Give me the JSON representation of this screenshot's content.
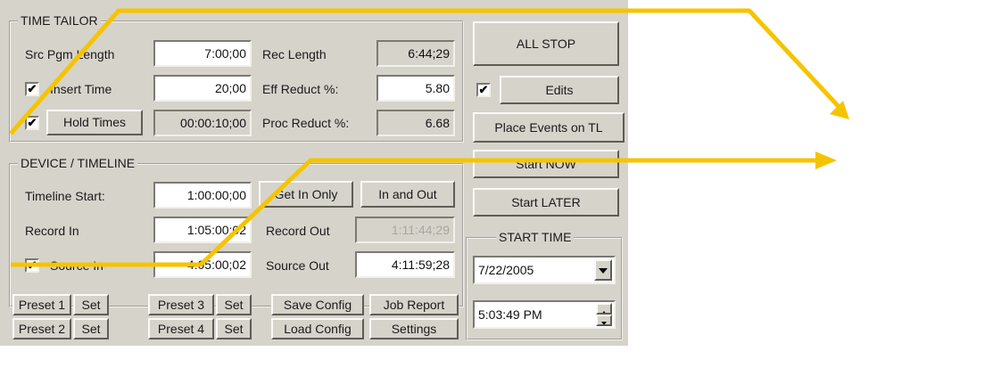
{
  "time_tailor": {
    "title": "TIME TAILOR",
    "src_pgm_length_label": "Src Pgm Length",
    "src_pgm_length_value": "7:00;00",
    "rec_length_label": "Rec Length",
    "rec_length_value": "6:44;29",
    "insert_time_label": "Insert Time",
    "insert_time_checked": true,
    "insert_time_value": "20;00",
    "eff_reduct_label": "Eff Reduct %:",
    "eff_reduct_value": "5.80",
    "hold_times_checked": true,
    "hold_times_label": "Hold Times",
    "hold_times_value": "00:00:10;00",
    "proc_reduct_label": "Proc Reduct %:",
    "proc_reduct_value": "6.68"
  },
  "device_timeline": {
    "title": "DEVICE / TIMELINE",
    "timeline_start_label": "Timeline Start:",
    "timeline_start_value": "1:00:00;00",
    "get_in_only_label": "Get In Only",
    "in_and_out_label": "In and Out",
    "record_in_label": "Record In",
    "record_in_value": "1:05:00;02",
    "record_out_label": "Record Out",
    "record_out_value": "1:11:44;29",
    "source_in_checked": true,
    "source_in_label": "Source In",
    "source_in_value": "4:05:00;02",
    "source_out_label": "Source Out",
    "source_out_value": "4:11:59;28"
  },
  "bottom_buttons": {
    "preset1": "Preset 1",
    "preset2": "Preset 2",
    "preset3": "Preset 3",
    "preset4": "Preset 4",
    "set": "Set",
    "save_config": "Save Config",
    "load_config": "Load Config",
    "job_report": "Job Report",
    "settings": "Settings"
  },
  "right_panel": {
    "all_stop": "ALL STOP",
    "edits_checked": true,
    "edits": "Edits",
    "place_events": "Place Events on TL",
    "start_now": "Start NOW",
    "start_later": "Start LATER",
    "start_time_title": "START TIME",
    "date_value": "7/22/2005",
    "time_value": "5:03:49 PM"
  },
  "check_glyph": "✔",
  "arrow_color": "#f5c400"
}
